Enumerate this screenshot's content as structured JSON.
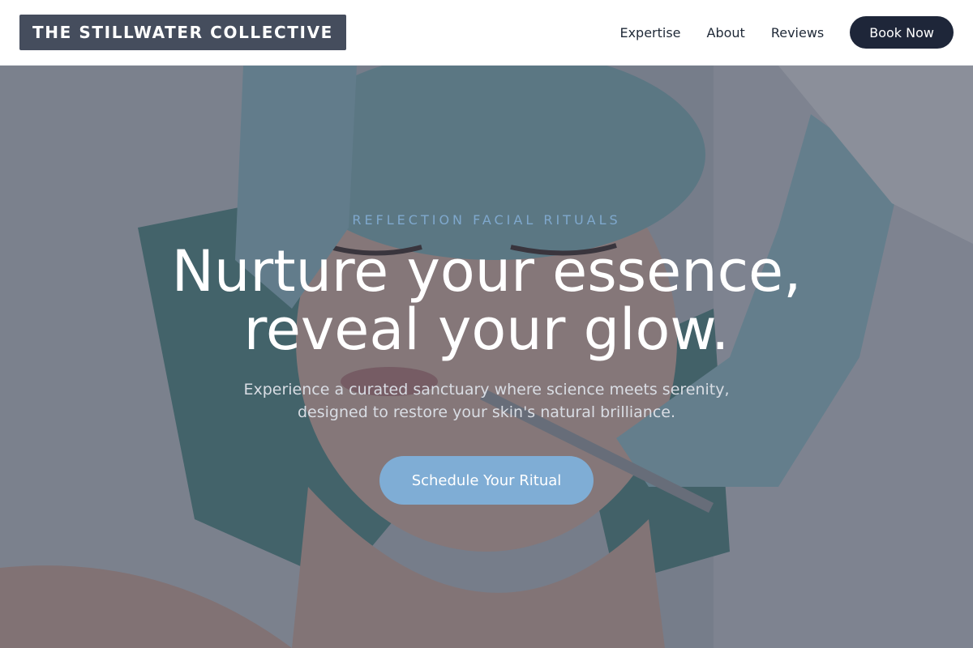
{
  "header": {
    "logo": "THE STILLWATER COLLECTIVE",
    "nav": [
      {
        "label": "Expertise"
      },
      {
        "label": "About"
      },
      {
        "label": "Reviews"
      }
    ],
    "book_label": "Book Now"
  },
  "hero": {
    "eyebrow": "REFLECTION FACIAL RITUALS",
    "headline_line1": "Nurture your essence,",
    "headline_line2": "reveal your glow.",
    "subtext_line1": "Experience a curated sanctuary where science meets serenity,",
    "subtext_line2": "designed to restore your skin's natural brilliance.",
    "cta_label": "Schedule Your Ritual",
    "photo": "woman-receiving-facial-treatment"
  },
  "colors": {
    "logo_bg": "#454d5d",
    "book_btn": "#1e2639",
    "accent": "#7fadd5",
    "eyebrow": "#7fa8cd"
  }
}
